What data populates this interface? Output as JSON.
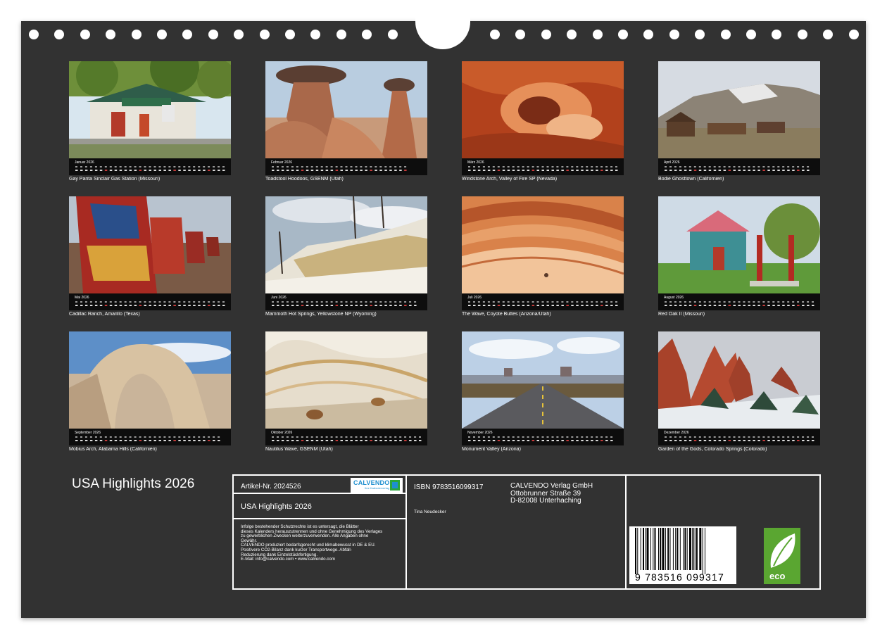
{
  "calendar_title": "USA Highlights 2026",
  "tiles": [
    {
      "month": "Januar 2026",
      "caption": "Gay Parita Sinclair Gas Station (Missouri)",
      "days": 31
    },
    {
      "month": "Februar 2026",
      "caption": "Toadstool Hoodoos, GSENM (Utah)",
      "days": 28
    },
    {
      "month": "März 2026",
      "caption": "Windstone Arch, Valley of Fire SP (Nevada)",
      "days": 31
    },
    {
      "month": "April 2026",
      "caption": "Bodie Ghosttown (Californien)",
      "days": 30
    },
    {
      "month": "Mai 2026",
      "caption": "Cadillac Ranch, Amarillo (Texas)",
      "days": 31
    },
    {
      "month": "Juni 2026",
      "caption": "Mammoth Hot Springs, Yellowstone NP (Wyoming)",
      "days": 30
    },
    {
      "month": "Juli 2026",
      "caption": "The Wave, Coyote Buttes (Arizona/Utah)",
      "days": 31
    },
    {
      "month": "August 2026",
      "caption": "Red Oak II (Missouri)",
      "days": 31
    },
    {
      "month": "September 2026",
      "caption": "Mobius Arch, Alabama Hills (Californien)",
      "days": 30
    },
    {
      "month": "Oktober 2026",
      "caption": "Nautilus Wave, GSENM (Utah)",
      "days": 31
    },
    {
      "month": "November 2026",
      "caption": "Monument Valley (Arizona)",
      "days": 30
    },
    {
      "month": "Dezember 2026",
      "caption": "Garden of the Gods, Colorado Springs (Colorado)",
      "days": 31
    }
  ],
  "info": {
    "artikel_nr": "Artikel-Nr. 2024526",
    "logo_text": "CALVENDO",
    "logo_sub": "Ihre Kalenderverlag",
    "title": "USA Highlights 2026",
    "legal_lines": [
      "Infolge bestehender Schutzrechte ist es untersagt, die Blätter",
      "dieses Kalenders herauszutrennen und ohne Genehmigung des Verlages",
      "zu gewerblichen Zwecken weiterzuverwenden. Alle Angaben ohne",
      "Gewähr.",
      "CALVENDO produziert bedarfsgerecht und klimabewusst in DE & EU.",
      "Positivere CO2-Bilanz dank kurzer Transportwege. Abfall-",
      "Reduzierung dank Einzelstückfertigung.",
      "E-Mail: info@calvendo.com • www.calvendo.com"
    ],
    "isbn": "ISBN 9783516099317",
    "publisher_lines": [
      "CALVENDO Verlag GmbH",
      "Ottobrunner Straße 39",
      "D-82008 Unterhaching"
    ],
    "author": "Tina Neudecker",
    "barcode_digits": "9 783516 099317",
    "eco_label": "eco"
  },
  "colors": {
    "board": "#323232",
    "calbar": "#0d0d0d",
    "text": "#ffffff",
    "eco_green": "#5aa631",
    "logo_blue": "#1e8fcf"
  }
}
